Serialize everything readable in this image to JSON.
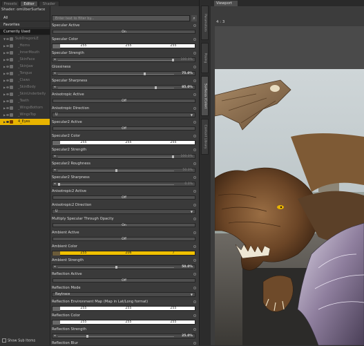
{
  "tabs": [
    {
      "label": "Presets"
    },
    {
      "label": "Editor"
    },
    {
      "label": "Shader Baker"
    }
  ],
  "shader_label": "Shader: omUberSurface",
  "categories": [
    {
      "label": "All"
    },
    {
      "label": "Favorites"
    },
    {
      "label": "Currently Used"
    }
  ],
  "tree": [
    {
      "label": "SubDragonLE"
    },
    {
      "label": "_Horns"
    },
    {
      "label": "_InnerMouth"
    },
    {
      "label": "_SkinFace"
    },
    {
      "label": "_SkinJaw"
    },
    {
      "label": "_Tongue"
    },
    {
      "label": "_Claws"
    },
    {
      "label": "_SkinBody"
    },
    {
      "label": "_SkinUnderbelly"
    },
    {
      "label": "_Teeth"
    },
    {
      "label": "_WingsBottom"
    },
    {
      "label": "_WingsTop"
    },
    {
      "label": "4_Eyes"
    }
  ],
  "show_sub_items": "Show Sub Items",
  "filter_placeholder": "Enter text to filter by...",
  "props": {
    "specular_active": {
      "label": "Specular Active",
      "value": "On"
    },
    "specular_color": {
      "label": "Specular Color",
      "r": "255",
      "g": "255",
      "b": "255"
    },
    "specular_strength": {
      "label": "Specular Strength",
      "value": "100.0%",
      "level": 1.0
    },
    "glossiness": {
      "label": "Glossiness",
      "value": "75.0%",
      "level": 0.75
    },
    "specular_sharpness": {
      "label": "Specular Sharpness",
      "value": "85.0%",
      "level": 0.85
    },
    "anisotropic_active": {
      "label": "Anisotropic Active",
      "value": "Off"
    },
    "anisotropic_direction": {
      "label": "Anisotropic Direction",
      "value": "U"
    },
    "specular2_active": {
      "label": "Specular2 Active",
      "value": "Off"
    },
    "specular2_color": {
      "label": "Specular2 Color",
      "r": "255",
      "g": "255",
      "b": "255"
    },
    "specular2_strength": {
      "label": "Specular2 Strength",
      "value": "100.0%",
      "level": 1.0
    },
    "specular2_roughness": {
      "label": "Specular2 Roughness",
      "value": "50.0%",
      "level": 0.5
    },
    "specular2_sharpness": {
      "label": "Specular2 Sharpness",
      "value": "0.0%",
      "level": 0.0
    },
    "anisotropic2_active": {
      "label": "Anisotropic2 Active",
      "value": "Off"
    },
    "anisotropic2_direction": {
      "label": "Anisotropic2 Direction",
      "value": "U"
    },
    "multiply_specular": {
      "label": "Multiply Specular Through Opacity",
      "value": "On"
    },
    "ambient_active": {
      "label": "Ambient Active",
      "value": "Off"
    },
    "ambient_color": {
      "label": "Ambient Color",
      "r": "255",
      "g": "206",
      "b": "7",
      "accent": "#f0c000"
    },
    "ambient_strength": {
      "label": "Ambient Strength",
      "value": "50.0%",
      "level": 0.5
    },
    "reflection_active": {
      "label": "Reflection Active",
      "value": "Off"
    },
    "reflection_mode": {
      "label": "Reflection Mode",
      "value": "Raytrace"
    },
    "reflection_env_map": {
      "label": "Reflection Environment Map (Map in Lat/Long format)",
      "r": "255",
      "g": "255",
      "b": "255"
    },
    "reflection_color": {
      "label": "Reflection Color",
      "r": "255",
      "g": "255",
      "b": "255"
    },
    "reflection_strength": {
      "label": "Reflection Strength",
      "value": "25.0%",
      "level": 0.25
    },
    "reflection_blur": {
      "label": "Reflection Blur"
    }
  },
  "side_tabs": [
    {
      "label": "Parameters"
    },
    {
      "label": "Posing"
    },
    {
      "label": "Surfaces (Color)"
    },
    {
      "label": "Content Library"
    }
  ],
  "viewport": {
    "tab": "Viewport",
    "view_label": "4 : 3"
  },
  "colors": {
    "selection": "#e8b400",
    "ambient": "#f0c000"
  }
}
